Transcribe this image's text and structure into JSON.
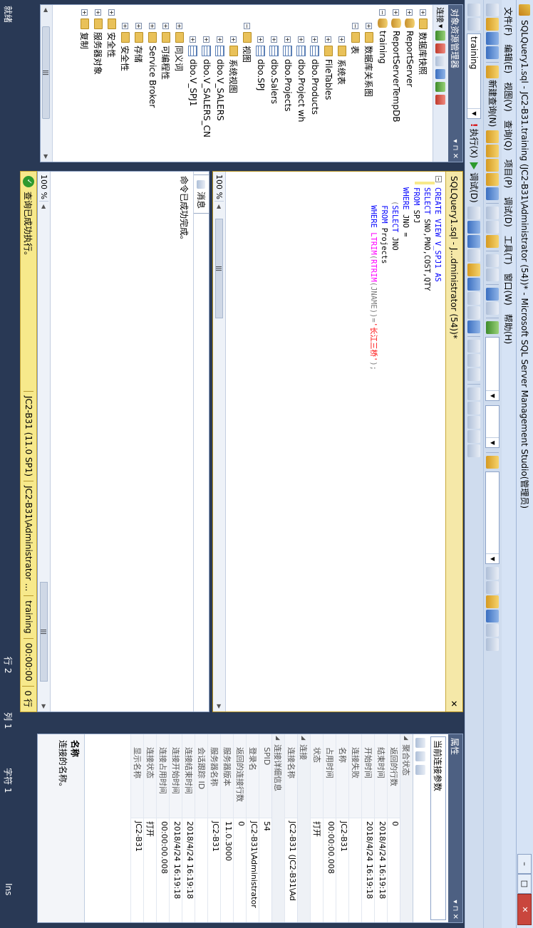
{
  "window": {
    "title": "SQLQuery1.sql - JC2-B31.training (JC2-B31\\Administrator (54))* - Microsoft SQL Server Management Studio(管理员)"
  },
  "menu": [
    "文件(F)",
    "编辑(E)",
    "视图(V)",
    "查询(Q)",
    "项目(P)",
    "调试(D)",
    "工具(T)",
    "窗口(W)",
    "帮助(H)"
  ],
  "toolbar": {
    "new_query": "新建查询(N)",
    "database": "training",
    "execute": "执行(X)",
    "debug": "调试(D)"
  },
  "object_explorer": {
    "title": "对象资源管理器",
    "connect": "连接",
    "tree": [
      {
        "label": "数据库快照",
        "type": "folder",
        "exp": "+"
      },
      {
        "label": "ReportServer",
        "type": "db",
        "exp": "+"
      },
      {
        "label": "ReportServerTempDB",
        "type": "db",
        "exp": "+"
      },
      {
        "label": "training",
        "type": "db",
        "exp": "−"
      },
      {
        "label": "数据库关系图",
        "type": "folder",
        "exp": "+"
      },
      {
        "label": "表",
        "type": "folder",
        "exp": "−"
      },
      {
        "label": "系统表",
        "type": "folder",
        "exp": "+"
      },
      {
        "label": "FileTables",
        "type": "folder",
        "exp": "+"
      },
      {
        "label": "dbo.Products",
        "type": "table",
        "exp": "+"
      },
      {
        "label": "dbo.Project wh",
        "type": "table",
        "exp": "+"
      },
      {
        "label": "dbo.Projects",
        "type": "table",
        "exp": "+"
      },
      {
        "label": "dbo.Salers",
        "type": "table",
        "exp": "+"
      },
      {
        "label": "dbo.SPJ",
        "type": "table",
        "exp": "+"
      },
      {
        "label": "视图",
        "type": "folder",
        "exp": "−"
      },
      {
        "label": "系统视图",
        "type": "folder",
        "exp": "+"
      },
      {
        "label": "dbo.V_SALERS",
        "type": "table",
        "exp": "+"
      },
      {
        "label": "dbo.V_SALERS_CN",
        "type": "table",
        "exp": "+"
      },
      {
        "label": "dbo.V_SPJ1",
        "type": "table",
        "exp": "+"
      },
      {
        "label": "同义词",
        "type": "folder",
        "exp": "+"
      },
      {
        "label": "可编程性",
        "type": "folder",
        "exp": "+"
      },
      {
        "label": "Service Broker",
        "type": "folder",
        "exp": "+"
      },
      {
        "label": "存储",
        "type": "folder",
        "exp": "+"
      },
      {
        "label": "安全性",
        "type": "folder",
        "exp": "+"
      },
      {
        "label": "安全性",
        "type": "folder",
        "exp": "+"
      },
      {
        "label": "服务器对象",
        "type": "folder",
        "exp": "+"
      },
      {
        "label": "复制",
        "type": "folder",
        "exp": "+"
      }
    ]
  },
  "editor": {
    "tab": "SQLQuery1.sql - J...dministrator (54))*",
    "zoom": "100 %",
    "lines": [
      [
        {
          "t": "CREATE VIEW V_SPJ1 AS",
          "c": "kw"
        }
      ],
      [
        {
          "t": "SELECT ",
          "c": "kw"
        },
        {
          "t": "SNO,PNO,COST,QTY",
          "c": ""
        }
      ],
      [
        {
          "t": "FROM ",
          "c": "kw"
        },
        {
          "t": "SPJ",
          "c": ""
        }
      ],
      [
        {
          "t": "WHERE ",
          "c": "kw"
        },
        {
          "t": "JNO =",
          "c": ""
        }
      ],
      [
        {
          "t": "   (",
          "c": "gr"
        },
        {
          "t": "SELECT ",
          "c": "kw"
        },
        {
          "t": "JNO",
          "c": ""
        }
      ],
      [
        {
          "t": "    FROM ",
          "c": "kw"
        },
        {
          "t": "Projects",
          "c": ""
        }
      ],
      [
        {
          "t": "    WHERE ",
          "c": "kw"
        },
        {
          "t": "LTRIM",
          "c": "fn"
        },
        {
          "t": "(",
          "c": "gr"
        },
        {
          "t": "RTRIM",
          "c": "fn"
        },
        {
          "t": "(JNAME))=",
          "c": "gr"
        },
        {
          "t": "'长江三桥'",
          "c": "str"
        },
        {
          "t": ");",
          "c": "gr"
        }
      ]
    ]
  },
  "results": {
    "tab": "消息",
    "message": "命令已成功完成。",
    "zoom": "100 %"
  },
  "query_status": {
    "message": "查询已成功执行。",
    "server": "JC2-B31 (11.0 SP1)",
    "user": "JC2-B31\\Administrator ...",
    "database": "training",
    "elapsed": "00:00:00",
    "rows": "0 行"
  },
  "properties": {
    "title": "属性",
    "combo": "当前连接参数",
    "groups": [
      {
        "name": "聚合状态",
        "rows": [
          {
            "k": "返回的行数",
            "v": "0"
          },
          {
            "k": "结束时间",
            "v": "2018/4/24 16:19:18"
          },
          {
            "k": "开始时间",
            "v": "2018/4/24 16:19:18"
          },
          {
            "k": "连接失败",
            "v": ""
          },
          {
            "k": "名称",
            "v": "JC2-B31"
          },
          {
            "k": "占用时间",
            "v": "00:00:00.008"
          },
          {
            "k": "状态",
            "v": "打开"
          }
        ]
      },
      {
        "name": "连接",
        "rows": [
          {
            "k": "连接名称",
            "v": "JC2-B31 (JC2-B31\\Ad"
          }
        ]
      },
      {
        "name": "连接详细信息",
        "rows": [
          {
            "k": "SPID",
            "v": "54"
          },
          {
            "k": "登录名",
            "v": "JC2-B31\\Administrator"
          },
          {
            "k": "返回的连接行数",
            "v": "0"
          },
          {
            "k": "服务器版本",
            "v": "11.0.3000"
          },
          {
            "k": "服务器名称",
            "v": "JC2-B31"
          },
          {
            "k": "会话跟踪 ID",
            "v": ""
          },
          {
            "k": "连接结束时间",
            "v": "2018/4/24 16:19:18"
          },
          {
            "k": "连接开始时间",
            "v": "2018/4/24 16:19:18"
          },
          {
            "k": "连接占用时间",
            "v": "00:00:00.008"
          },
          {
            "k": "连接状态",
            "v": "打开"
          },
          {
            "k": "显示名称",
            "v": "JC2-B31"
          }
        ]
      }
    ],
    "desc_title": "名称",
    "desc_text": "连接的名称。"
  },
  "statusbar": {
    "ready": "就绪",
    "row": "行 2",
    "col": "列 1",
    "char": "字符 1",
    "ins": "Ins"
  }
}
